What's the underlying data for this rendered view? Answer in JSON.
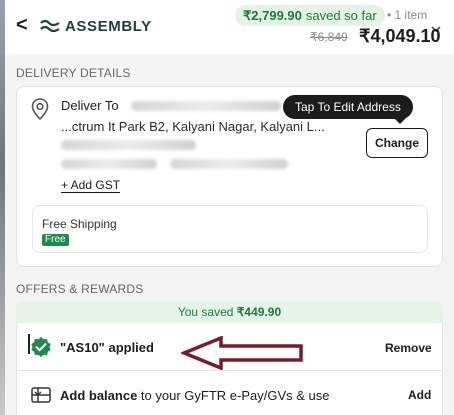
{
  "header": {
    "back_glyph": "<",
    "logo_text": "ASSEMBLY",
    "logo_icon": "assembly-wave-logo",
    "saved_amount": "₹2,799.90",
    "saved_suffix": "saved so far",
    "item_separator": "•",
    "item_count": "1 item",
    "old_price": "₹6,849",
    "new_price": "₹4,049.10",
    "expand_icon": "chevron-down-icon"
  },
  "delivery": {
    "section_title": "DELIVERY DETAILS",
    "deliver_to_label": "Deliver To",
    "address_line": "...ctrum It Park B2, Kalyani Nagar, Kalyani L...",
    "tooltip": "Tap To Edit Address",
    "change_label": "Change",
    "add_gst_label": "+ Add GST",
    "shipping_title": "Free Shipping",
    "shipping_badge": "Free"
  },
  "offers": {
    "section_title": "OFFERS & REWARDS",
    "saved_prefix": "You saved",
    "saved_amount": "₹449.90",
    "coupon_text": "\"AS10\" applied",
    "remove_label": "Remove",
    "balance_bold": "Add balance",
    "balance_rest": "to your GyFTR e-Pay/GVs & use",
    "add_label": "Add"
  },
  "colors": {
    "accent_green": "#1e8a4c",
    "saved_bg": "#e4f4e6",
    "annotation_arrow": "#7a1a2a"
  }
}
